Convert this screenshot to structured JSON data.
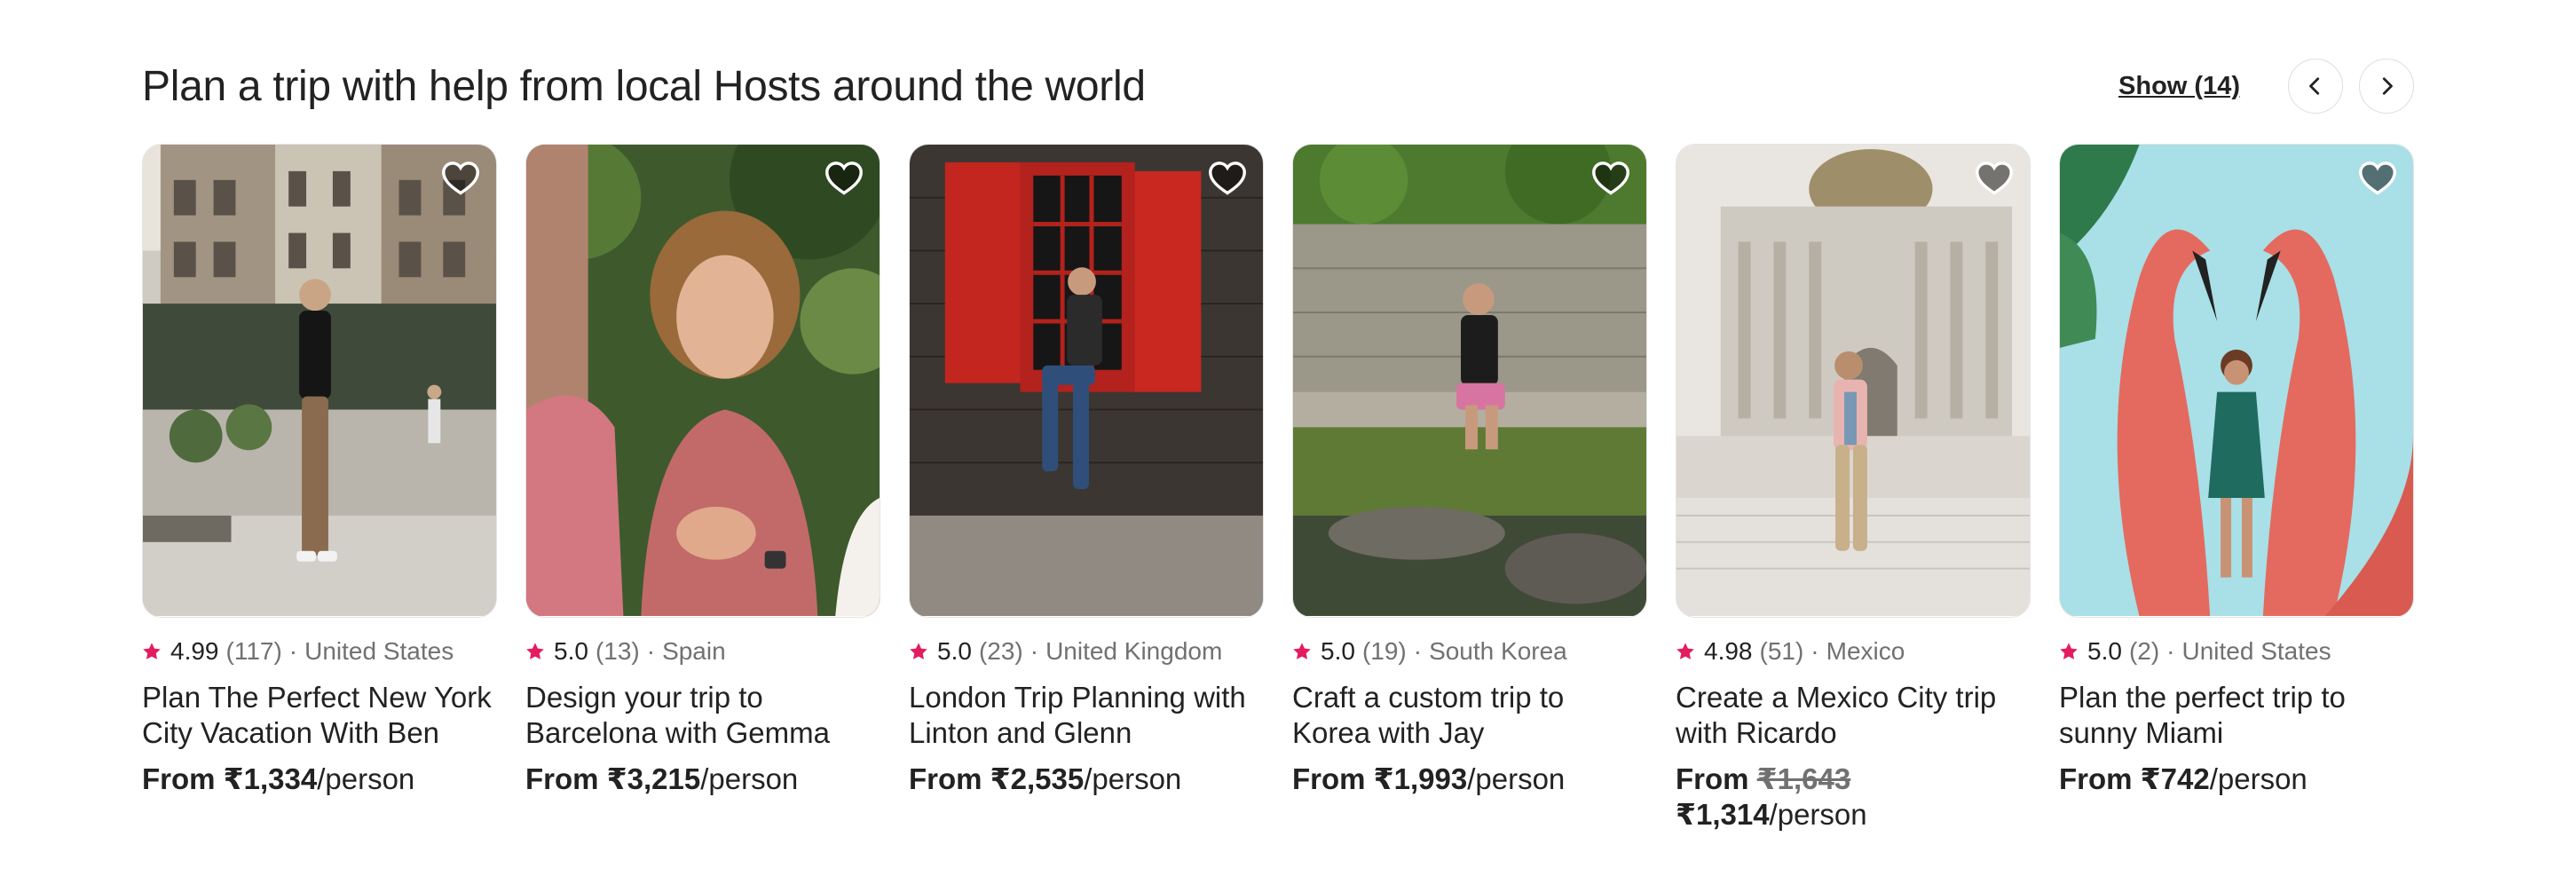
{
  "section": {
    "title": "Plan a trip with help from local Hosts around the world",
    "show_label": "Show (14)",
    "prev_icon": "chevron-left-icon",
    "next_icon": "chevron-right-icon"
  },
  "colors": {
    "star": "#E31C5F",
    "text_primary": "#222222",
    "text_secondary": "#717171"
  },
  "cards": [
    {
      "rating": "4.99",
      "reviews": "(117)",
      "dot": "·",
      "location": "United States",
      "title": "Plan The Perfect New York City Vacation With Ben",
      "price_prefix": "From ",
      "price": "₹1,334",
      "price_suffix": "/person"
    },
    {
      "rating": "5.0",
      "reviews": "(13)",
      "dot": "·",
      "location": "Spain",
      "title": "Design your trip to Barcelona with Gemma",
      "price_prefix": "From ",
      "price": "₹3,215",
      "price_suffix": "/person"
    },
    {
      "rating": "5.0",
      "reviews": "(23)",
      "dot": "·",
      "location": "United Kingdom",
      "title": "London Trip Planning with Linton and Glenn",
      "price_prefix": "From ",
      "price": "₹2,535",
      "price_suffix": "/person"
    },
    {
      "rating": "5.0",
      "reviews": "(19)",
      "dot": "·",
      "location": "South Korea",
      "title": "Craft a custom trip to Korea with Jay",
      "price_prefix": "From ",
      "price": "₹1,993",
      "price_suffix": "/person"
    },
    {
      "rating": "4.98",
      "reviews": "(51)",
      "dot": "·",
      "location": "Mexico",
      "title": "Create a Mexico City trip with Ricardo",
      "price_prefix": "From ",
      "original_price": "₹1,643",
      "price": "₹1,314",
      "price_suffix": "/person"
    },
    {
      "rating": "5.0",
      "reviews": "(2)",
      "dot": "·",
      "location": "United States",
      "title": "Plan the perfect trip to sunny Miami",
      "price_prefix": "From ",
      "price": "₹742",
      "price_suffix": "/person"
    }
  ]
}
